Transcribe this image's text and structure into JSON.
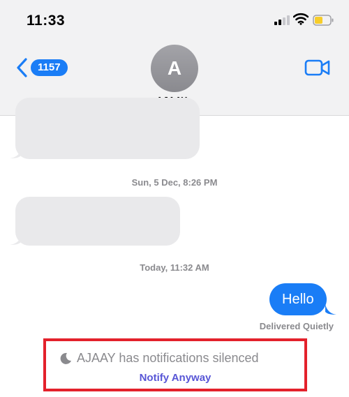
{
  "status_bar": {
    "time": "11:33"
  },
  "header": {
    "back_badge": "1157",
    "avatar_initial": "A",
    "contact_name": "AJAAY",
    "contact_chevron": "›"
  },
  "messages": {
    "timestamp_1": "Sun, 5 Dec, 8:26 PM",
    "timestamp_2": "Today, 11:32 AM",
    "outgoing_text": "Hello",
    "delivered_status": "Delivered Quietly"
  },
  "notice": {
    "silenced_text": "AJAAY has notifications silenced",
    "notify_button": "Notify Anyway"
  },
  "colors": {
    "accent_blue": "#1a7df6",
    "bubble_gray": "#e9e9eb",
    "notify_purple": "#5856d6",
    "highlight_red": "#e3212b",
    "battery_yellow": "#f7cd2a"
  }
}
